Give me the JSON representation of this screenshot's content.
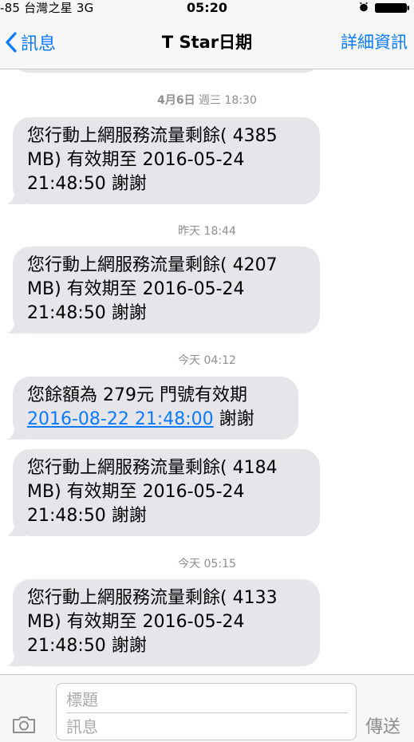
{
  "status": {
    "carrier": "-85 台灣之星  3G",
    "time": "05:20"
  },
  "nav": {
    "back_label": "訊息",
    "title": "T Star日期",
    "detail_label": "詳細資訊"
  },
  "messages": [
    {
      "timestamp_date": "4月6日",
      "timestamp_rest": " 週三 18:30",
      "lines": [
        "您行動上網服務流量剩餘(  4385",
        "MB) 有效期至   2016-05-24",
        "21:48:50 謝謝"
      ]
    },
    {
      "timestamp": "昨天 18:44",
      "lines": [
        "您行動上網服務流量剩餘(  4207",
        "MB) 有效期至   2016-05-24",
        "21:48:50 謝謝"
      ]
    },
    {
      "timestamp": "今天 04:12",
      "line1": "您餘額為  279元  門號有效期",
      "link": "2016-08-22 21:48:00",
      "link_suffix": " 謝謝"
    },
    {
      "lines": [
        "您行動上網服務流量剩餘(  4184",
        "MB) 有效期至   2016-05-24",
        "21:48:50 謝謝"
      ]
    },
    {
      "timestamp": "今天 05:15",
      "lines": [
        "您行動上網服務流量剩餘(  4133",
        "MB) 有效期至   2016-05-24",
        "21:48:50 謝謝"
      ]
    }
  ],
  "compose": {
    "subject_placeholder": "標題",
    "message_placeholder": "訊息",
    "send_label": "傳送"
  },
  "colors": {
    "accent": "#0a7aff",
    "bubble": "#e5e5ea",
    "muted": "#8e8e93"
  },
  "icons": {
    "back": "chevron-left-icon",
    "alarm": "alarm-clock-icon",
    "battery": "battery-icon",
    "camera": "camera-icon"
  }
}
